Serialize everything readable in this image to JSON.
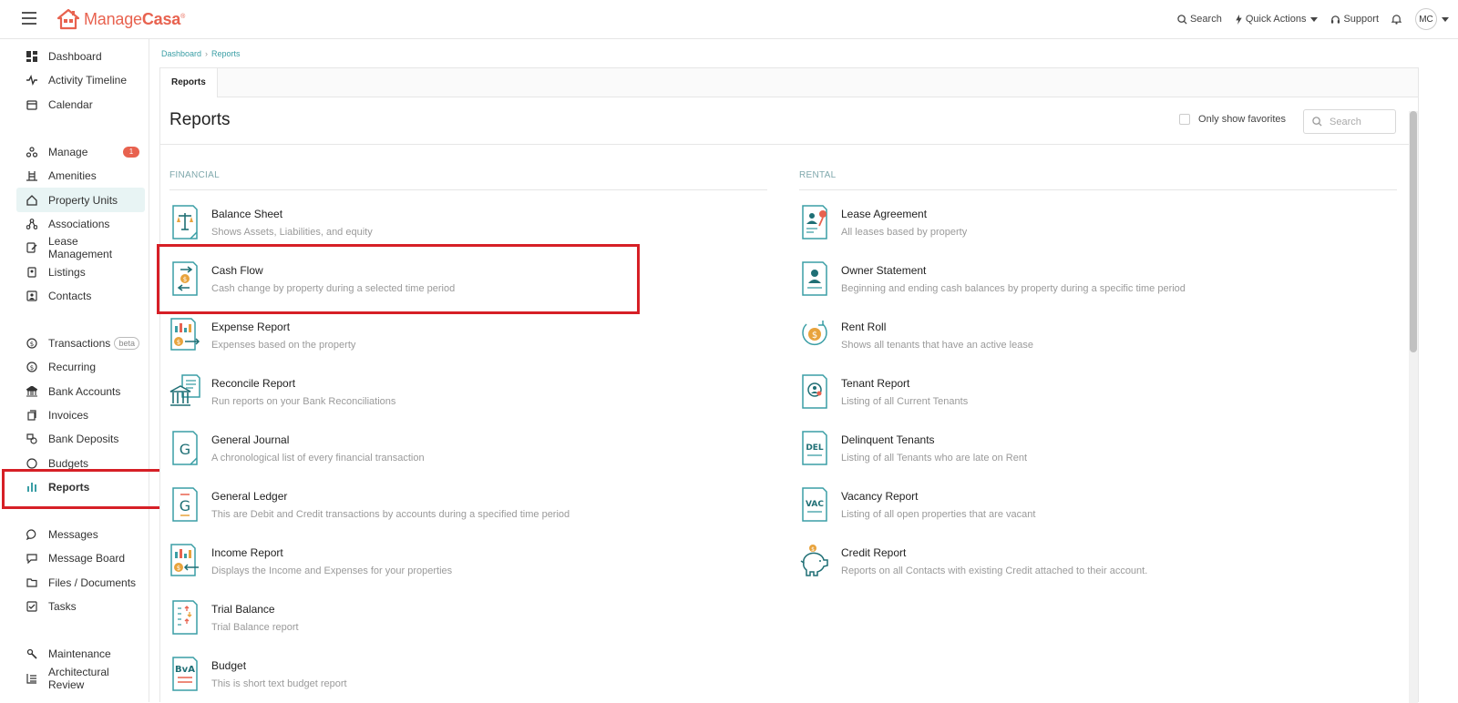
{
  "app": {
    "brand_light": "Manage",
    "brand_bold": "Casa",
    "brand_mark": "®",
    "accent": "#e8624f",
    "teal": "#3a9ea5"
  },
  "topbar": {
    "search_label": "Search",
    "quick_actions_label": "Quick Actions",
    "support_label": "Support",
    "avatar_initials": "MC"
  },
  "sidebar": {
    "groups": [
      [
        {
          "label": "Dashboard",
          "icon": "dashboard-icon"
        },
        {
          "label": "Activity Timeline",
          "icon": "activity-icon"
        },
        {
          "label": "Calendar",
          "icon": "calendar-icon"
        }
      ],
      [
        {
          "label": "Manage",
          "icon": "manage-icon",
          "badge": "1"
        },
        {
          "label": "Amenities",
          "icon": "amenities-icon"
        },
        {
          "label": "Property Units",
          "icon": "home-icon",
          "active": true
        },
        {
          "label": "Associations",
          "icon": "associations-icon"
        },
        {
          "label": "Lease Management",
          "icon": "lease-icon"
        },
        {
          "label": "Listings",
          "icon": "listings-icon"
        },
        {
          "label": "Contacts",
          "icon": "contacts-icon"
        }
      ],
      [
        {
          "label": "Transactions",
          "icon": "dollar-icon",
          "beta": "beta"
        },
        {
          "label": "Recurring",
          "icon": "recurring-icon"
        },
        {
          "label": "Bank Accounts",
          "icon": "bank-icon"
        },
        {
          "label": "Invoices",
          "icon": "invoice-icon"
        },
        {
          "label": "Bank Deposits",
          "icon": "deposit-icon"
        },
        {
          "label": "Budgets",
          "icon": "budget-icon"
        },
        {
          "label": "Reports",
          "icon": "bar-chart-icon"
        }
      ],
      [
        {
          "label": "Messages",
          "icon": "message-icon"
        },
        {
          "label": "Message Board",
          "icon": "message-board-icon"
        },
        {
          "label": "Files / Documents",
          "icon": "folder-icon"
        },
        {
          "label": "Tasks",
          "icon": "tasks-icon"
        }
      ],
      [
        {
          "label": "Maintenance",
          "icon": "wrench-icon"
        },
        {
          "label": "Architectural Review",
          "icon": "review-icon"
        }
      ]
    ]
  },
  "breadcrumb": {
    "root": "Dashboard",
    "sep": "›",
    "current": "Reports"
  },
  "tabs": [
    {
      "label": "Reports"
    }
  ],
  "main": {
    "title": "Reports",
    "favorites_label": "Only show favorites",
    "search_placeholder": "Search"
  },
  "sections": {
    "financial": {
      "title": "FINANCIAL",
      "items": [
        {
          "title": "Balance Sheet",
          "desc": "Shows Assets, Liabilities, and equity",
          "icon": "balance-scale-icon"
        },
        {
          "title": "Cash Flow",
          "desc": "Cash change by property during a selected time period",
          "icon": "cash-flow-icon"
        },
        {
          "title": "Expense Report",
          "desc": "Expenses based on the property",
          "icon": "expense-report-icon"
        },
        {
          "title": "Reconcile Report",
          "desc": "Run reports on your Bank Reconciliations",
          "icon": "reconcile-bank-icon"
        },
        {
          "title": "General Journal",
          "desc": "A chronological list of every financial transaction",
          "icon": "general-journal-icon"
        },
        {
          "title": "General Ledger",
          "desc": "This are Debit and Credit transactions by accounts during a specified time period",
          "icon": "general-ledger-icon"
        },
        {
          "title": "Income Report",
          "desc": "Displays the Income and Expenses for your properties",
          "icon": "income-report-icon"
        },
        {
          "title": "Trial Balance",
          "desc": "Trial Balance report",
          "icon": "trial-balance-icon"
        },
        {
          "title": "Budget",
          "desc": "This is short text budget report",
          "icon": "budget-report-icon"
        }
      ]
    },
    "rental": {
      "title": "RENTAL",
      "items": [
        {
          "title": "Lease Agreement",
          "desc": "All leases based by property",
          "icon": "lease-agreement-icon"
        },
        {
          "title": "Owner Statement",
          "desc": "Beginning and ending cash balances by property during a specific time period",
          "icon": "owner-statement-icon"
        },
        {
          "title": "Rent Roll",
          "desc": "Shows all tenants that have an active lease",
          "icon": "rent-roll-icon"
        },
        {
          "title": "Tenant Report",
          "desc": "Listing of all Current Tenants",
          "icon": "tenant-report-icon"
        },
        {
          "title": "Delinquent Tenants",
          "desc": "Listing of all Tenants who are late on Rent",
          "icon": "delinquent-icon"
        },
        {
          "title": "Vacancy Report",
          "desc": "Listing of all open properties that are vacant",
          "icon": "vacancy-icon"
        },
        {
          "title": "Credit Report",
          "desc": "Reports on all Contacts with existing Credit attached to their account.",
          "icon": "piggy-bank-icon"
        }
      ]
    }
  },
  "icon_labels": {
    "del": "DEL",
    "vac": "VAC",
    "bva": "BvA",
    "g": "G",
    "dollar": "$"
  }
}
